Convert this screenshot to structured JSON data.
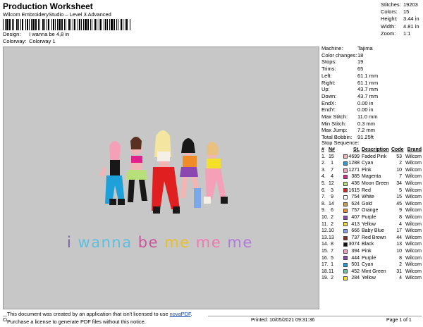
{
  "header": {
    "title": "Production Worksheet",
    "subtitle": "Wilcom EmbroideryStudio – Level 3 Advanced",
    "design_label": "Design:",
    "design_value": "I wanna be 4,8 in",
    "colorway_label": "Colorway:",
    "colorway_value": "Colorway 1"
  },
  "stats": [
    {
      "label": "Stitches:",
      "value": "19203"
    },
    {
      "label": "Colors:",
      "value": "15"
    },
    {
      "label": "Height:",
      "value": "3.44 in"
    },
    {
      "label": "Width:",
      "value": "4.81 in"
    },
    {
      "label": "Zoom:",
      "value": "1:1"
    }
  ],
  "design": {
    "caption_words": [
      "i",
      "wanna",
      "be",
      "me",
      "me",
      "me"
    ],
    "caption_colors": [
      "#7a5fb0",
      "#5bc0e0",
      "#c9549b",
      "#f2d23c",
      "#ef7ab0",
      "#b27ad8"
    ]
  },
  "machine_info": [
    {
      "label": "Machine:",
      "value": "Tajima"
    },
    {
      "label": "Color changes:",
      "value": "18"
    },
    {
      "label": "Stops:",
      "value": "19"
    },
    {
      "label": "Trims:",
      "value": "65"
    },
    {
      "label": "Left:",
      "value": "61.1 mm"
    },
    {
      "label": "Right:",
      "value": "61.1 mm"
    },
    {
      "label": "Up:",
      "value": "43.7 mm"
    },
    {
      "label": "Down:",
      "value": "43.7 mm"
    },
    {
      "label": "EndX:",
      "value": "0.00 in"
    },
    {
      "label": "EndY:",
      "value": "0.00 in"
    },
    {
      "label": "Max Stitch:",
      "value": "11.0 mm"
    },
    {
      "label": "Min Stitch:",
      "value": "0.3 mm"
    },
    {
      "label": "Max Jump:",
      "value": "7.2 mm"
    },
    {
      "label": "Total Bobbin:",
      "value": "91.25ft"
    }
  ],
  "stop_sequence": {
    "title": "Stop Sequence:",
    "headers": [
      "#",
      "N#",
      "St.",
      "Description",
      "Code",
      "Brand"
    ],
    "rows": [
      {
        "num": "1.",
        "n": "15",
        "color": "#f0b6b6",
        "st": "4699",
        "desc": "Faded Pink",
        "code": "53",
        "brand": "Wilcom"
      },
      {
        "num": "2.",
        "n": "1",
        "color": "#1ea0d8",
        "st": "1288",
        "desc": "Cyan",
        "code": "2",
        "brand": "Wilcom"
      },
      {
        "num": "3.",
        "n": "7",
        "color": "#f4a0b8",
        "st": "1271",
        "desc": "Pink",
        "code": "10",
        "brand": "Wilcom"
      },
      {
        "num": "4.",
        "n": "4",
        "color": "#e0208c",
        "st": "385",
        "desc": "Magenta",
        "code": "7",
        "brand": "Wilcom"
      },
      {
        "num": "5.",
        "n": "12",
        "color": "#b8e07a",
        "st": "436",
        "desc": "Moon Green",
        "code": "34",
        "brand": "Wilcom"
      },
      {
        "num": "6.",
        "n": "3",
        "color": "#e02020",
        "st": "1615",
        "desc": "Red",
        "code": "5",
        "brand": "Wilcom"
      },
      {
        "num": "7.",
        "n": "9",
        "color": "#ffffff",
        "st": "754",
        "desc": "White",
        "code": "15",
        "brand": "Wilcom"
      },
      {
        "num": "8.",
        "n": "14",
        "color": "#c8a040",
        "st": "624",
        "desc": "Gold",
        "code": "45",
        "brand": "Wilcom"
      },
      {
        "num": "9.",
        "n": "6",
        "color": "#f08c28",
        "st": "757",
        "desc": "Orange",
        "code": "9",
        "brand": "Wilcom"
      },
      {
        "num": "10.",
        "n": "2",
        "color": "#8a48b0",
        "st": "407",
        "desc": "Purple",
        "code": "8",
        "brand": "Wilcom"
      },
      {
        "num": "11.",
        "n": "2",
        "color": "#f4e028",
        "st": "413",
        "desc": "Yellow",
        "code": "4",
        "brand": "Wilcom"
      },
      {
        "num": "12.",
        "n": "10",
        "color": "#7aa8e8",
        "st": "666",
        "desc": "Baby Blue",
        "code": "17",
        "brand": "Wilcom"
      },
      {
        "num": "13.",
        "n": "13",
        "color": "#8a3020",
        "st": "737",
        "desc": "Red Brown",
        "code": "44",
        "brand": "Wilcom"
      },
      {
        "num": "14.",
        "n": "8",
        "color": "#101010",
        "st": "3074",
        "desc": "Black",
        "code": "13",
        "brand": "Wilcom"
      },
      {
        "num": "15.",
        "n": "7",
        "color": "#f4a0b8",
        "st": "394",
        "desc": "Pink",
        "code": "10",
        "brand": "Wilcom"
      },
      {
        "num": "16.",
        "n": "5",
        "color": "#8a48b0",
        "st": "444",
        "desc": "Purple",
        "code": "8",
        "brand": "Wilcom"
      },
      {
        "num": "17.",
        "n": "1",
        "color": "#1ea0d8",
        "st": "501",
        "desc": "Cyan",
        "code": "2",
        "brand": "Wilcom"
      },
      {
        "num": "18.",
        "n": "11",
        "color": "#5ec8a8",
        "st": "452",
        "desc": "Mint Green",
        "code": "31",
        "brand": "Wilcom"
      },
      {
        "num": "19.",
        "n": "2",
        "color": "#f4e028",
        "st": "284",
        "desc": "Yellow",
        "code": "4",
        "brand": "Wilcom"
      }
    ]
  },
  "notice": {
    "line1_prefix": "This document was created by an application that isn't licensed to use ",
    "link": "novaPDF",
    "line1_suffix": ".",
    "line2": "Purchase a license to generate PDF files without this notice."
  },
  "footer": {
    "left": "Cr",
    "printed": "Printed: 10/05/2021 09:31:36",
    "page": "Page 1 of 1"
  }
}
